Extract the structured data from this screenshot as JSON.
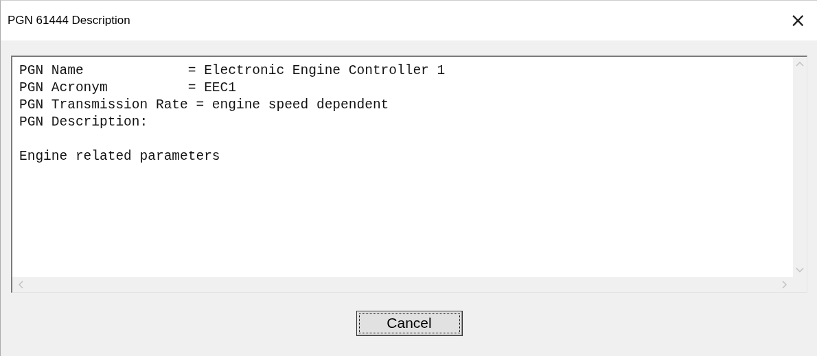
{
  "window": {
    "title": "PGN 61444 Description",
    "close": "×"
  },
  "text_area": {
    "lines": [
      "PGN Name             = Electronic Engine Controller 1",
      "PGN Acronym          = EEC1",
      "PGN Transmission Rate = engine speed dependent",
      "PGN Description:"
    ],
    "body": "Engine related parameters"
  },
  "buttons": [
    {
      "label": "Cancel",
      "focused": true
    }
  ]
}
